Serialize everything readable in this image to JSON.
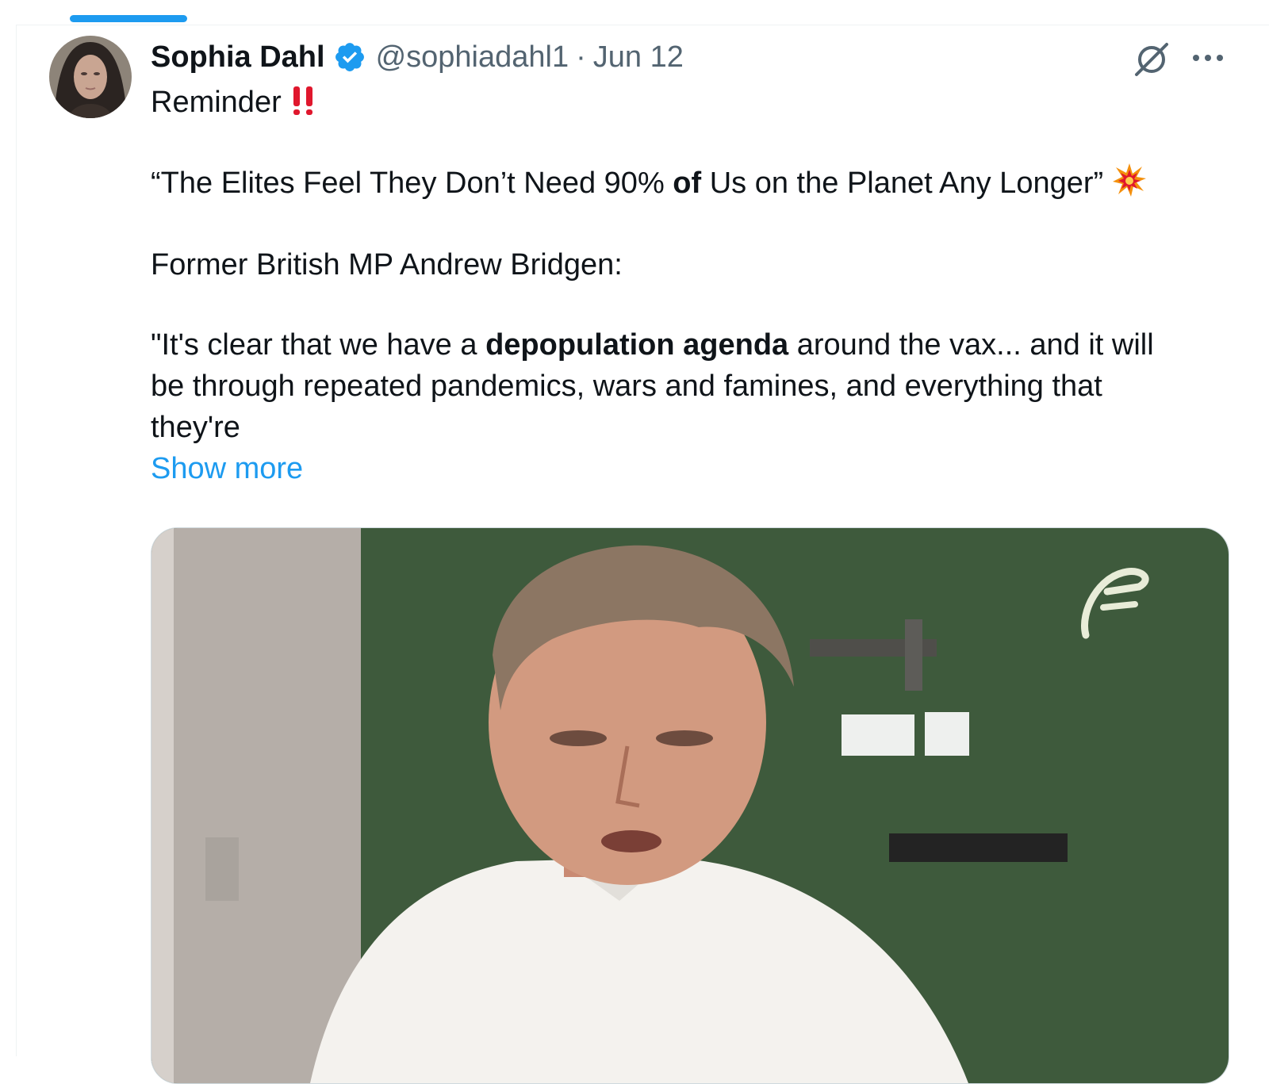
{
  "tweet": {
    "author": {
      "display_name": "Sophia Dahl",
      "handle": "@sophiadahl1",
      "verified": true
    },
    "separator": "·",
    "date": "Jun 12",
    "text": {
      "line1": "Reminder",
      "line2_a": "“The Elites Feel They Don’t Need 90% ",
      "line2_bold": "of",
      "line2_b": " Us on the Planet Any Longer”",
      "line3": "Former British MP Andrew Bridgen:",
      "line4_a": " \"It's clear that we have a ",
      "line4_bold": "depopulation agenda",
      "line4_b": " around the vax... and it will",
      "line5": "be through repeated pandemics, wars and famines, and everything that",
      "line6": "they're"
    },
    "show_more_label": "Show more",
    "icons": {
      "verified": "verified-badge-icon",
      "grok": "grok-icon",
      "more": "more-options-icon",
      "emoji_1": "double-exclamation-emoji",
      "emoji_2": "collision-emoji"
    },
    "colors": {
      "accent": "#1d9bf0",
      "secondary_text": "#536471",
      "emoji_red": "#e0172d"
    }
  }
}
